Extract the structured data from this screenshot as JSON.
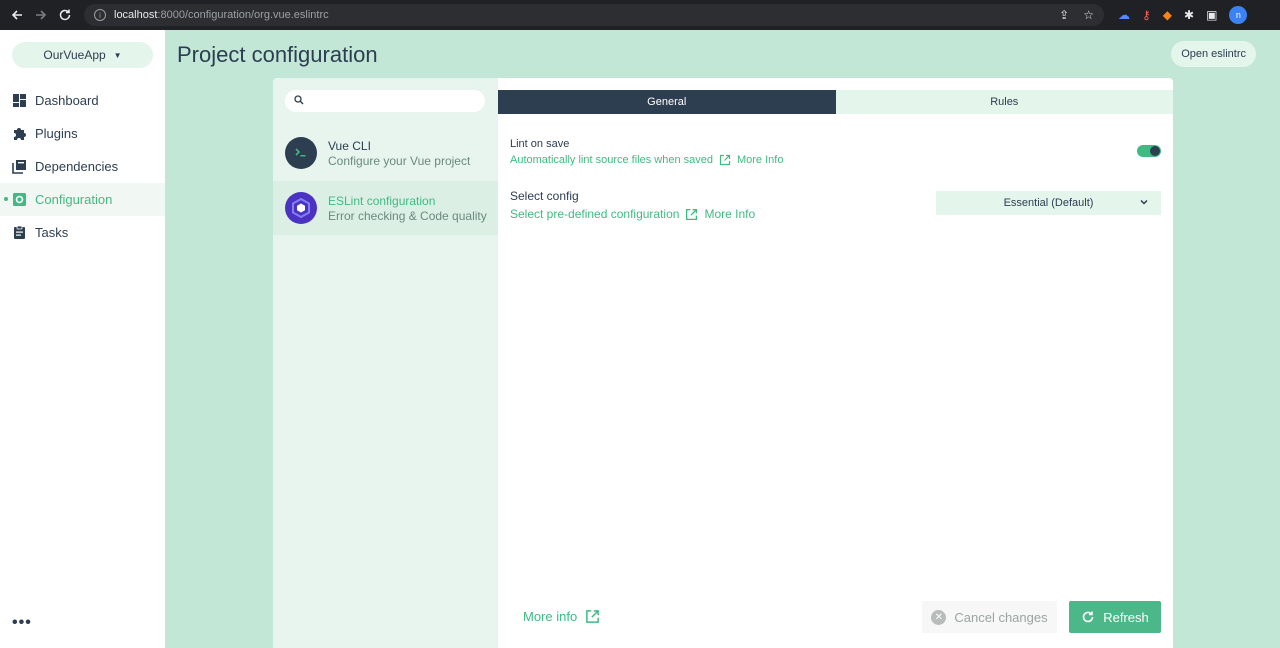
{
  "browser": {
    "url_host": "localhost",
    "url_rest": ":8000/configuration/org.vue.eslintrc",
    "avatar_letter": "n"
  },
  "sidebar": {
    "project_name": "OurVueApp",
    "items": [
      {
        "label": "Dashboard",
        "icon": "dashboard-icon"
      },
      {
        "label": "Plugins",
        "icon": "puzzle-icon"
      },
      {
        "label": "Dependencies",
        "icon": "library-icon"
      },
      {
        "label": "Configuration",
        "icon": "settings-applications-icon",
        "active": true
      },
      {
        "label": "Tasks",
        "icon": "clipboard-icon"
      }
    ],
    "more_label": "•••"
  },
  "header": {
    "title": "Project configuration",
    "open_button": "Open eslintrc"
  },
  "configs": [
    {
      "name": "Vue CLI",
      "description": "Configure your Vue project"
    },
    {
      "name": "ESLint configuration",
      "description": "Error checking & Code quality"
    }
  ],
  "tabs": [
    {
      "label": "General",
      "active": true
    },
    {
      "label": "Rules",
      "active": false
    }
  ],
  "prompts": {
    "lint_on_save": {
      "name": "Lint on save",
      "description": "Automatically lint source files when saved",
      "more": "More Info",
      "value": true
    },
    "select_config": {
      "name": "Select config",
      "description": "Select pre-defined configuration",
      "more": "More Info",
      "selected": "Essential (Default)"
    }
  },
  "footer": {
    "more_info": "More info",
    "cancel": "Cancel changes",
    "refresh": "Refresh"
  },
  "colors": {
    "accent": "#42b983",
    "dark": "#2c3e50",
    "background": "#c2e7d6"
  }
}
